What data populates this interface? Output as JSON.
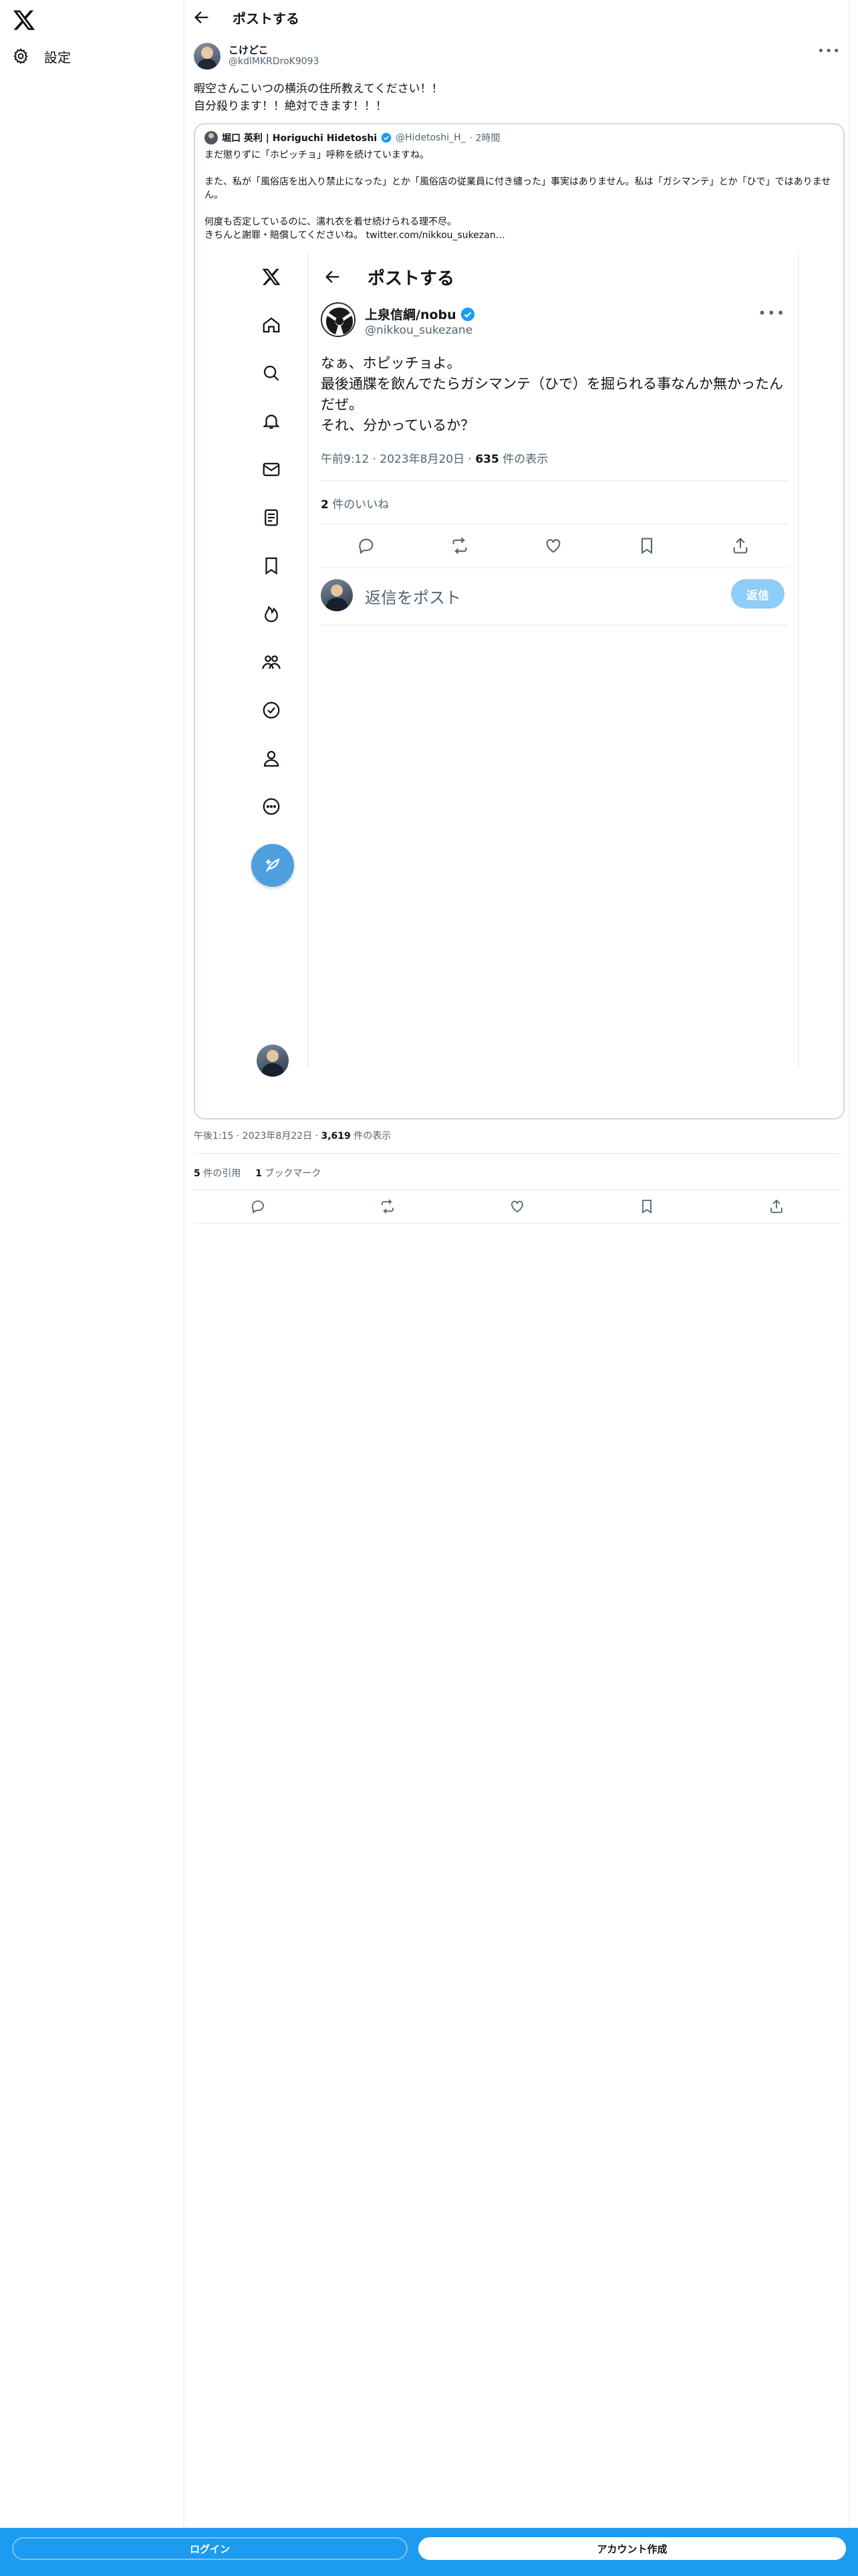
{
  "nav": {
    "settings_label": "設定"
  },
  "header": {
    "title": "ポストする"
  },
  "post": {
    "author_name": "こけどこ",
    "author_handle": "@kdlMKRDroK9093",
    "text_line1": "暇空さんこいつの横浜の住所教えてください！！",
    "text_line2": "自分殺ります！！絶対できます！！！",
    "timestamp": "午後1:15 · 2023年8月22日",
    "view_count": "3,619",
    "view_label": "件の表示",
    "quotes_count": "5",
    "quotes_label": "件の引用",
    "bookmarks_count": "1",
    "bookmarks_label": "ブックマーク"
  },
  "quoted": {
    "author_name": "堀口 英利 | Horiguchi Hidetoshi",
    "author_handle": "@Hidetoshi_H_",
    "time": "· 2時間",
    "para1": "まだ懲りずに「ホピッチョ」呼称を続けていますね。",
    "para2": "また、私が「風俗店を出入り禁止になった」とか「風俗店の従業員に付き纏った」事実はありません。私は「ガシマンテ」とか「ひで」ではありません。",
    "para3a": "何度も否定しているのに、濡れ衣を着せ続けられる理不尽。",
    "para3b": "きちんと謝罪・賠償してくださいね。",
    "link": "twitter.com/nikkou_sukezan…"
  },
  "screenshot": {
    "title": "ポストする",
    "author_name": "上泉信綱/nobu",
    "author_handle": "@nikkou_sukezane",
    "text_line1": "なぁ、ホピッチョよ。",
    "text_line2": "最後通牒を飲んでたらガシマンテ（ひで）を掘られる事なんか無かったんだぜ。",
    "text_line3": "それ、分かっているか？",
    "meta_time": "午前9:12 · 2023年8月20日 ·",
    "meta_views": "635",
    "meta_views_label": "件の表示",
    "likes_count": "2",
    "likes_label": "件のいいね",
    "reply_placeholder": "返信をポスト",
    "reply_button": "返信"
  },
  "bottom": {
    "login": "ログイン",
    "signup": "アカウント作成"
  },
  "colors": {
    "accent": "#1d9bf0",
    "verified": "#1d9bf0",
    "border": "#cfd9de",
    "muted": "#536471"
  }
}
